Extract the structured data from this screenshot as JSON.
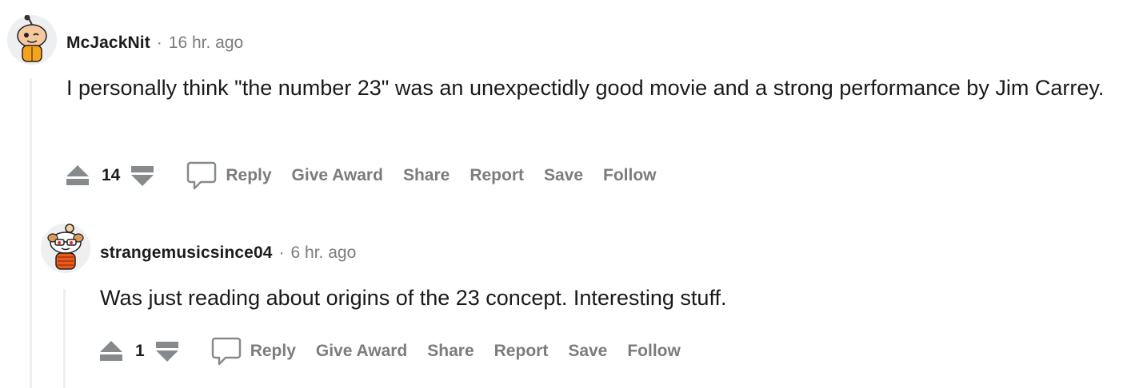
{
  "comments": [
    {
      "username": "McJackNit",
      "separator": "·",
      "timestamp": "16 hr. ago",
      "body": "I personally think \"the number 23\" was an unexpectidly good movie and a strong performance by Jim Carrey.",
      "score": "14",
      "avatar_icon": "snoo-avatar-icon",
      "actions": {
        "reply": "Reply",
        "give_award": "Give Award",
        "share": "Share",
        "report": "Report",
        "save": "Save",
        "follow": "Follow"
      }
    },
    {
      "username": "strangemusicsince04",
      "separator": "·",
      "timestamp": "6 hr. ago",
      "body": "Was just reading about origins of the 23 concept. Interesting stuff.",
      "score": "1",
      "avatar_icon": "snoo-avatar-icon",
      "actions": {
        "reply": "Reply",
        "give_award": "Give Award",
        "share": "Share",
        "report": "Report",
        "save": "Save",
        "follow": "Follow"
      }
    }
  ],
  "colors": {
    "meta": "#7c7c7c",
    "text": "#1a1a1b",
    "thread": "#edeff1"
  }
}
